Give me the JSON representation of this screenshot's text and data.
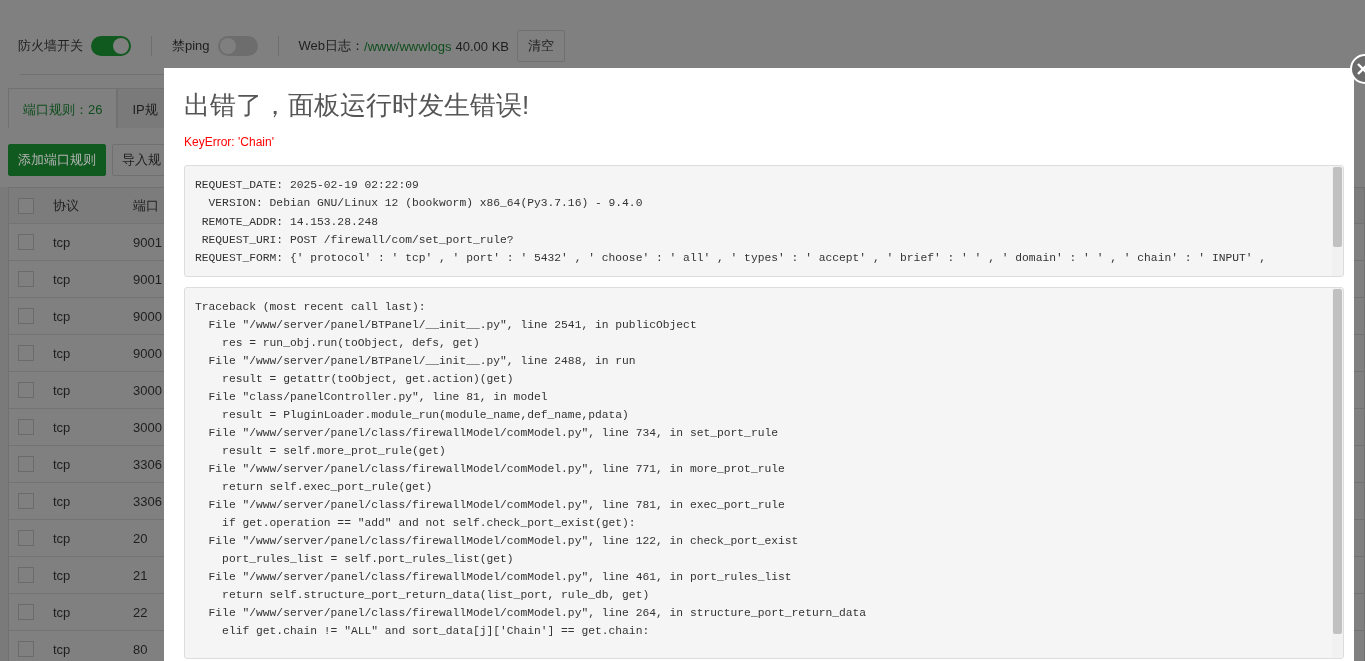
{
  "toolbar": {
    "switches": [
      {
        "label": "防火墙开关",
        "on": true
      },
      {
        "label": "禁ping",
        "on": false
      }
    ],
    "web_log": {
      "label": "Web日志：",
      "path": "/www/wwwlogs",
      "size": "40.00 KB"
    },
    "clear_button": "清空"
  },
  "tabs": [
    {
      "label": "端口规则：26",
      "selected": true
    },
    {
      "label": "IP规",
      "selected": false
    }
  ],
  "actions": [
    {
      "label": "添加端口规则",
      "kind": "primary"
    },
    {
      "label": "导入规",
      "kind": "default"
    }
  ],
  "table": {
    "header_checked": false,
    "columns": [
      "协议",
      "端口"
    ],
    "rows": [
      {
        "checked": false,
        "protocol": "tcp",
        "port": "9001"
      },
      {
        "checked": false,
        "protocol": "tcp",
        "port": "9001"
      },
      {
        "checked": false,
        "protocol": "tcp",
        "port": "9000"
      },
      {
        "checked": false,
        "protocol": "tcp",
        "port": "9000"
      },
      {
        "checked": false,
        "protocol": "tcp",
        "port": "3000"
      },
      {
        "checked": false,
        "protocol": "tcp",
        "port": "3000"
      },
      {
        "checked": false,
        "protocol": "tcp",
        "port": "3306"
      },
      {
        "checked": false,
        "protocol": "tcp",
        "port": "3306"
      },
      {
        "checked": false,
        "protocol": "tcp",
        "port": "20"
      },
      {
        "checked": false,
        "protocol": "tcp",
        "port": "21"
      },
      {
        "checked": false,
        "protocol": "tcp",
        "port": "22"
      },
      {
        "checked": false,
        "protocol": "tcp",
        "port": "80"
      }
    ]
  },
  "dialog": {
    "title": "出错了，面板运行时发生错误!",
    "error": "KeyError: 'Chain'",
    "request_info": [
      "REQUEST_DATE: 2025-02-19 02:22:09",
      "  VERSION: Debian GNU/Linux 12 (bookworm) x86_64(Py3.7.16) - 9.4.0",
      " REMOTE_ADDR: 14.153.28.248",
      " REQUEST_URI: POST /firewall/com/set_port_rule?",
      "REQUEST_FORM: {' protocol' : ' tcp' , ' port' : ' 5432' , ' choose' : ' all' , ' types' : ' accept' , ' brief' : ' ' , ' domain' : ' ' , ' chain' : ' INPUT' ,"
    ],
    "traceback": [
      "Traceback (most recent call last):",
      "  File \"/www/server/panel/BTPanel/__init__.py\", line 2541, in publicObject",
      "    res = run_obj.run(toObject, defs, get)",
      "  File \"/www/server/panel/BTPanel/__init__.py\", line 2488, in run",
      "    result = getattr(toObject, get.action)(get)",
      "  File \"class/panelController.py\", line 81, in model",
      "    result = PluginLoader.module_run(module_name,def_name,pdata)",
      "  File \"/www/server/panel/class/firewallModel/comModel.py\", line 734, in set_port_rule",
      "    result = self.more_prot_rule(get)",
      "  File \"/www/server/panel/class/firewallModel/comModel.py\", line 771, in more_prot_rule",
      "    return self.exec_port_rule(get)",
      "  File \"/www/server/panel/class/firewallModel/comModel.py\", line 781, in exec_port_rule",
      "    if get.operation == \"add\" and not self.check_port_exist(get):",
      "  File \"/www/server/panel/class/firewallModel/comModel.py\", line 122, in check_port_exist",
      "    port_rules_list = self.port_rules_list(get)",
      "  File \"/www/server/panel/class/firewallModel/comModel.py\", line 461, in port_rules_list",
      "    return self.structure_port_return_data(list_port, rule_db, get)",
      "  File \"/www/server/panel/class/firewallModel/comModel.py\", line 264, in structure_port_return_data",
      "    elif get.chain != \"ALL\" and sort_data[j]['Chain'] == get.chain:"
    ]
  }
}
